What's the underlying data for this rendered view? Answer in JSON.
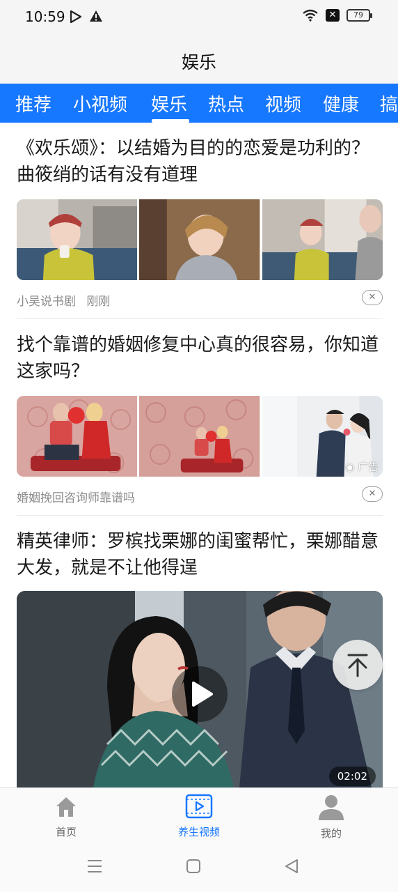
{
  "status_bar": {
    "time": "10:59",
    "battery": "79"
  },
  "header": {
    "title": "娱乐"
  },
  "tabs": [
    {
      "label": "推荐"
    },
    {
      "label": "小视频"
    },
    {
      "label": "娱乐",
      "active": true
    },
    {
      "label": "热点"
    },
    {
      "label": "视频"
    },
    {
      "label": "健康"
    },
    {
      "label": "搞"
    }
  ],
  "articles": [
    {
      "title": "《欢乐颂》：以结婚为目的的恋爱是功利的？曲筱绡的话有没有道理",
      "source": "小吴说书剧",
      "time": "刚刚"
    },
    {
      "title": "找个靠谱的婚姻修复中心真的很容易，你知道这家吗？",
      "source": "婚姻挽回咨询师靠谱吗",
      "ad_label": "广告"
    },
    {
      "title": "精英律师：罗槟找栗娜的闺蜜帮忙，栗娜醋意大发，就是不让他得逞",
      "duration": "02:02"
    }
  ],
  "bottom_nav": [
    {
      "label": "首页",
      "icon": "home-icon"
    },
    {
      "label": "养生视频",
      "icon": "video-icon",
      "active": true
    },
    {
      "label": "我的",
      "icon": "user-icon"
    }
  ],
  "colors": {
    "accent": "#1677ff",
    "text": "#1a1a1a",
    "meta": "#8a8a8a"
  }
}
